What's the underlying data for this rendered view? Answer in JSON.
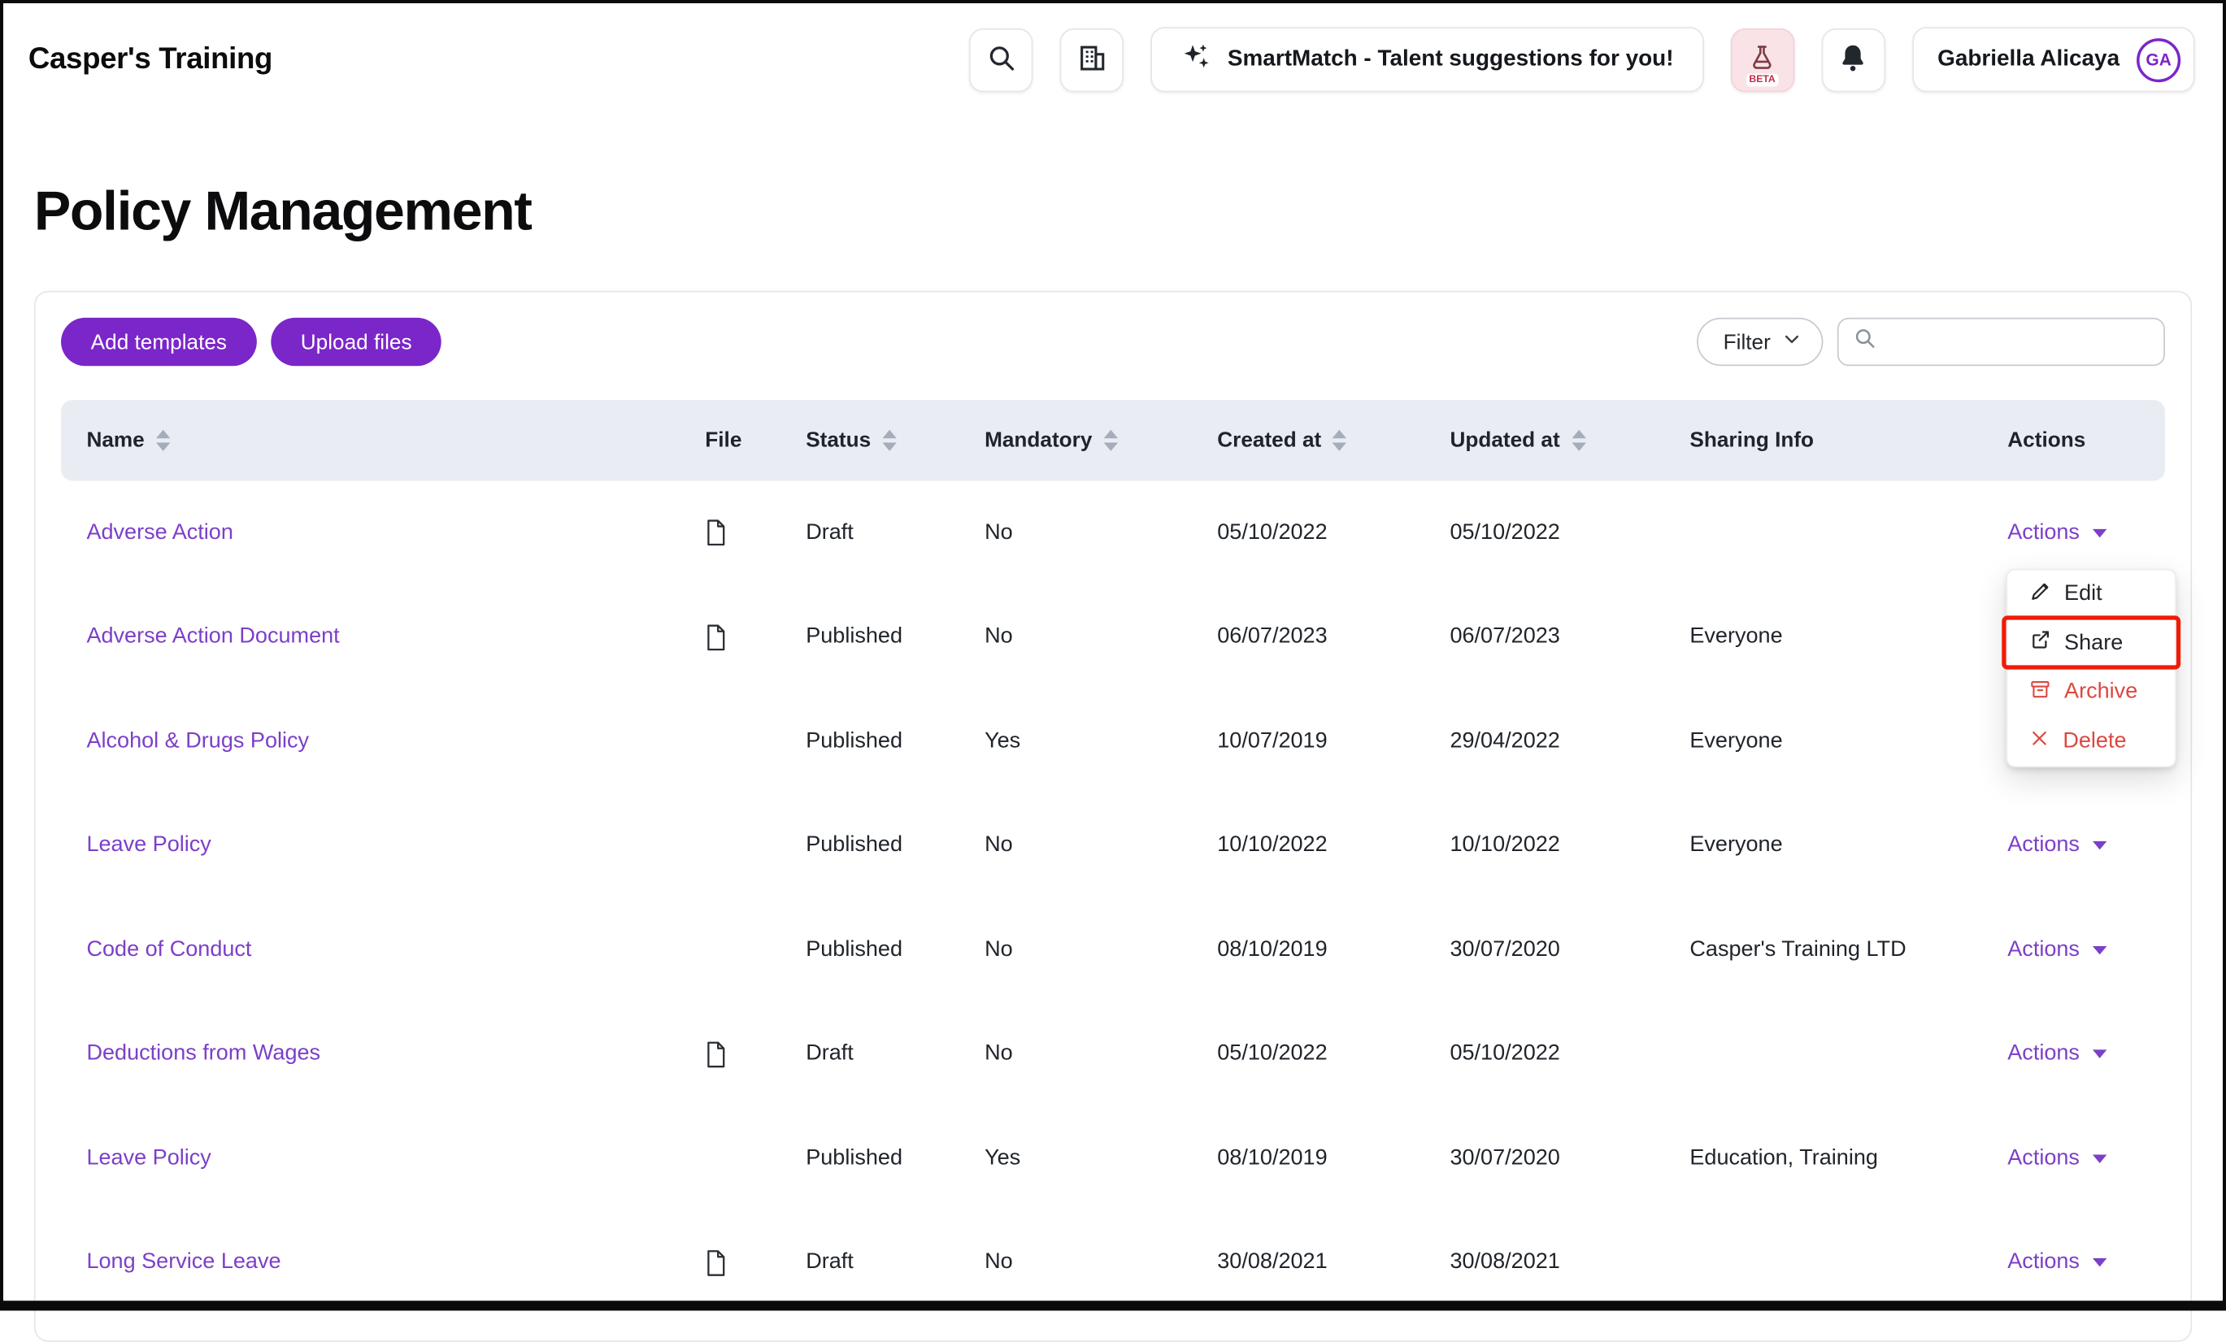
{
  "header": {
    "logo": "Casper's Training",
    "smartmatch_label": "SmartMatch - Talent suggestions for you!",
    "beta_badge": "BETA",
    "user": {
      "name": "Gabriella Alicaya",
      "initials": "GA"
    }
  },
  "page": {
    "title": "Policy Management"
  },
  "toolbar": {
    "add_templates_label": "Add templates",
    "upload_files_label": "Upload files",
    "filter_label": "Filter",
    "search_placeholder": ""
  },
  "table": {
    "actions_label": "Actions",
    "columns": [
      {
        "label": "Name",
        "sortable": true
      },
      {
        "label": "File",
        "sortable": false
      },
      {
        "label": "Status",
        "sortable": true
      },
      {
        "label": "Mandatory",
        "sortable": true
      },
      {
        "label": "Created at",
        "sortable": true
      },
      {
        "label": "Updated at",
        "sortable": true
      },
      {
        "label": "Sharing Info",
        "sortable": false
      },
      {
        "label": "Actions",
        "sortable": false
      }
    ],
    "rows": [
      {
        "name": "Adverse Action",
        "file": true,
        "status": "Draft",
        "mandatory": "No",
        "created_at": "05/10/2022",
        "updated_at": "05/10/2022",
        "sharing": ""
      },
      {
        "name": "Adverse Action Document",
        "file": true,
        "status": "Published",
        "mandatory": "No",
        "created_at": "06/07/2023",
        "updated_at": "06/07/2023",
        "sharing": "Everyone"
      },
      {
        "name": "Alcohol & Drugs Policy",
        "file": false,
        "status": "Published",
        "mandatory": "Yes",
        "created_at": "10/07/2019",
        "updated_at": "29/04/2022",
        "sharing": "Everyone"
      },
      {
        "name": "Leave Policy",
        "file": false,
        "status": "Published",
        "mandatory": "No",
        "created_at": "10/10/2022",
        "updated_at": "10/10/2022",
        "sharing": "Everyone"
      },
      {
        "name": "Code of Conduct",
        "file": false,
        "status": "Published",
        "mandatory": "No",
        "created_at": "08/10/2019",
        "updated_at": "30/07/2020",
        "sharing": "Casper's Training LTD"
      },
      {
        "name": "Deductions from Wages",
        "file": true,
        "status": "Draft",
        "mandatory": "No",
        "created_at": "05/10/2022",
        "updated_at": "05/10/2022",
        "sharing": ""
      },
      {
        "name": "Leave Policy",
        "file": false,
        "status": "Published",
        "mandatory": "Yes",
        "created_at": "08/10/2019",
        "updated_at": "30/07/2020",
        "sharing": "Education, Training"
      },
      {
        "name": "Long Service Leave",
        "file": true,
        "status": "Draft",
        "mandatory": "No",
        "created_at": "30/08/2021",
        "updated_at": "30/08/2021",
        "sharing": ""
      }
    ]
  },
  "actions_menu": {
    "items": [
      {
        "label": "Edit",
        "danger": false,
        "annotated": false
      },
      {
        "label": "Share",
        "danger": false,
        "annotated": true
      },
      {
        "label": "Archive",
        "danger": true,
        "annotated": false
      },
      {
        "label": "Delete",
        "danger": true,
        "annotated": false
      }
    ]
  },
  "colors": {
    "brand_purple": "#7B26C9",
    "link_purple": "#7C3FC8",
    "danger": "#DC4840",
    "table_header_bg": "#E9EDF3",
    "annotation_red": "#F11A05"
  }
}
